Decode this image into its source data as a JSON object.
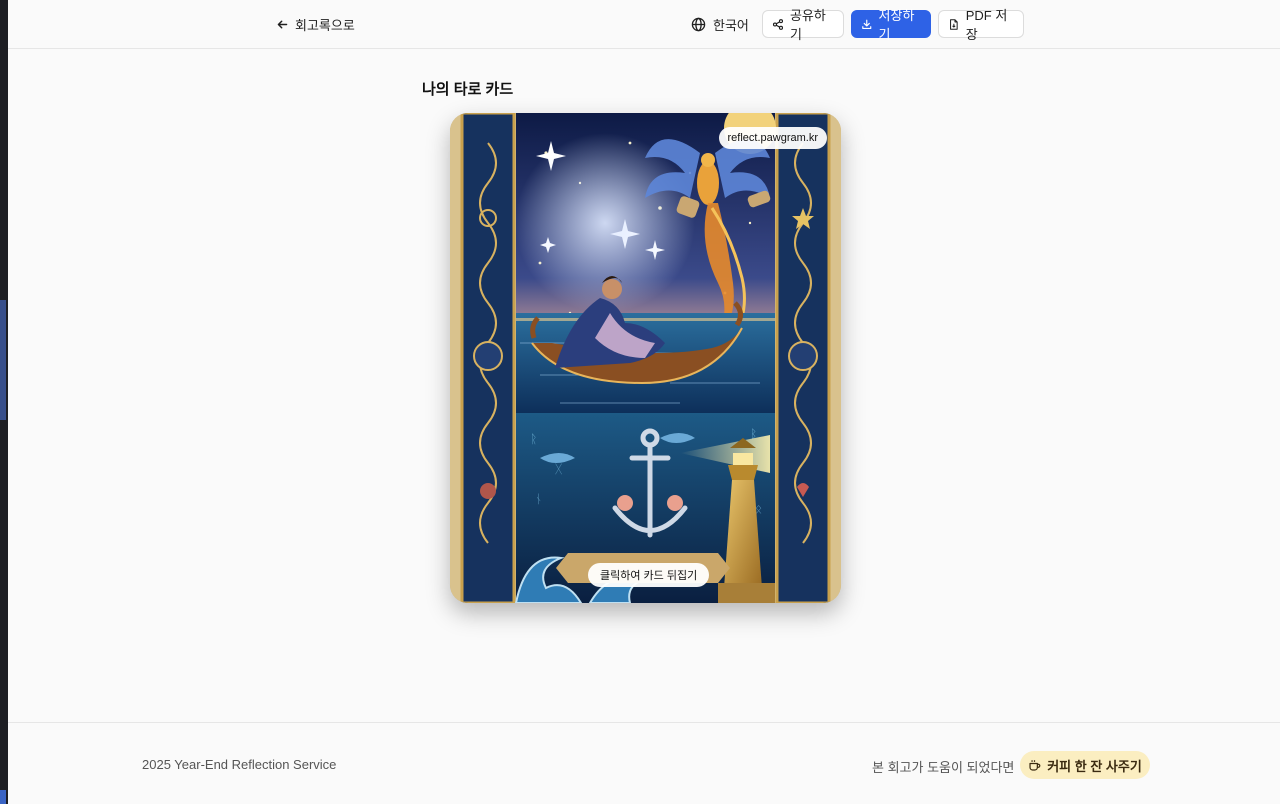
{
  "header": {
    "back_label": "회고록으로",
    "language_label": "한국어",
    "share_label": "공유하기",
    "save_label": "저장하기",
    "pdf_label": "PDF 저장"
  },
  "main": {
    "section_title": "나의 타로 카드",
    "card": {
      "watermark": "reflect.pawgram.kr",
      "flip_hint": "클릭하여 카드 뒤집기"
    }
  },
  "footer": {
    "copyright": "2025 Year-End Reflection Service",
    "help_text": "본 회고가 도움이 되었다면",
    "coffee_label": "커피 한 잔 사주기"
  },
  "colors": {
    "accent": "#2e62e6",
    "coffee_bg": "#fbeec1"
  }
}
